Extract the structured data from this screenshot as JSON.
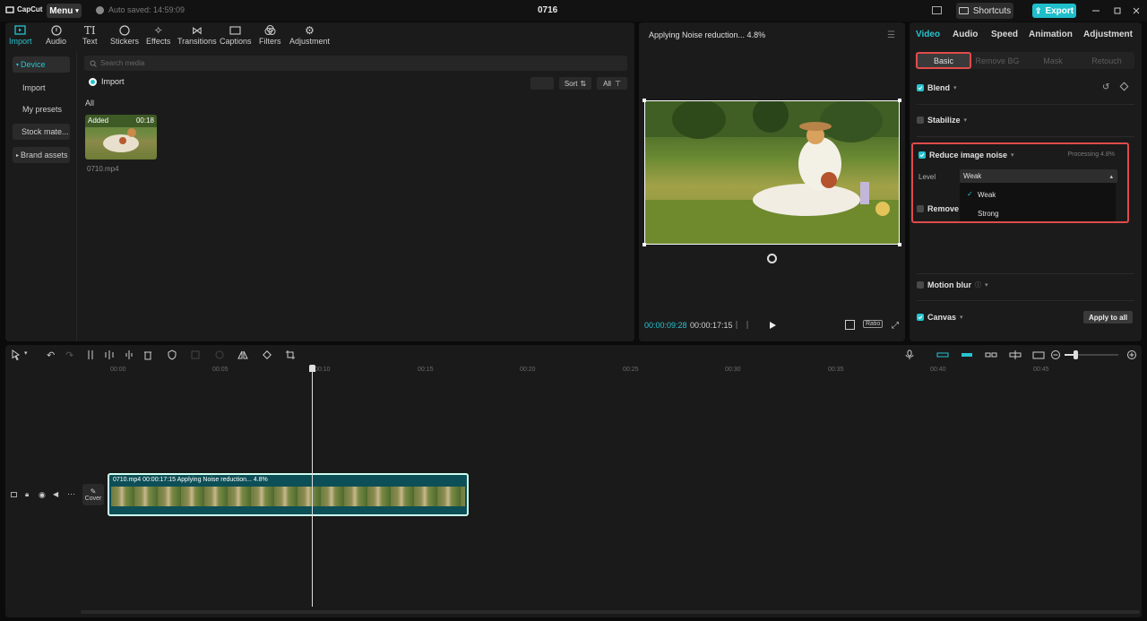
{
  "app": {
    "name": "CapCut",
    "menu_label": "Menu",
    "autosave": "Auto saved: 14:59:09",
    "project_title": "0716",
    "shortcuts_label": "Shortcuts",
    "export_label": "Export",
    "accent": "#27c4d0",
    "highlight": "#e04b4b"
  },
  "media_tabs": [
    {
      "label": "Import",
      "icon": "import-icon"
    },
    {
      "label": "Audio",
      "icon": "audio-icon"
    },
    {
      "label": "Text",
      "icon": "text-icon"
    },
    {
      "label": "Stickers",
      "icon": "stickers-icon"
    },
    {
      "label": "Effects",
      "icon": "effects-icon"
    },
    {
      "label": "Transitions",
      "icon": "transitions-icon"
    },
    {
      "label": "Captions",
      "icon": "captions-icon"
    },
    {
      "label": "Filters",
      "icon": "filters-icon"
    },
    {
      "label": "Adjustment",
      "icon": "adjustment-icon"
    }
  ],
  "media_side": [
    "Device",
    "Import",
    "My presets",
    "Stock mate...",
    "Brand assets"
  ],
  "media": {
    "search_placeholder": "Search media",
    "import_label": "Import",
    "sort_label": "Sort",
    "filter_label": "All",
    "section_label": "All",
    "item": {
      "status": "Added",
      "duration": "00:18",
      "name": "0710.mp4"
    }
  },
  "player": {
    "title": "Applying Noise reduction... 4.8%",
    "current_time": "00:00:09:28",
    "total_time": "00:00:17:15",
    "ratio_label": "Ratio"
  },
  "props": {
    "tabs": [
      "Video",
      "Audio",
      "Speed",
      "Animation",
      "Adjustment"
    ],
    "subtabs": [
      "Basic",
      "Remove BG",
      "Mask",
      "Retouch"
    ],
    "blend_label": "Blend",
    "stabilize_label": "Stabilize",
    "noise_label": "Reduce image noise",
    "processing": "Processing 4.8%",
    "level_label": "Level",
    "level_value": "Weak",
    "level_options": [
      "Weak",
      "Strong"
    ],
    "remove_label": "Remove",
    "motion_blur_label": "Motion blur",
    "canvas_label": "Canvas",
    "apply_all_label": "Apply to all"
  },
  "timeline": {
    "ticks": [
      "00:00",
      "00:05",
      "00:10",
      "00:15",
      "00:20",
      "00:25",
      "00:30",
      "00:35",
      "00:40",
      "00:45"
    ],
    "cover_label": "Cover",
    "clip_label": "0710.mp4  00:00:17:15  Applying Noise reduction... 4.8%"
  }
}
